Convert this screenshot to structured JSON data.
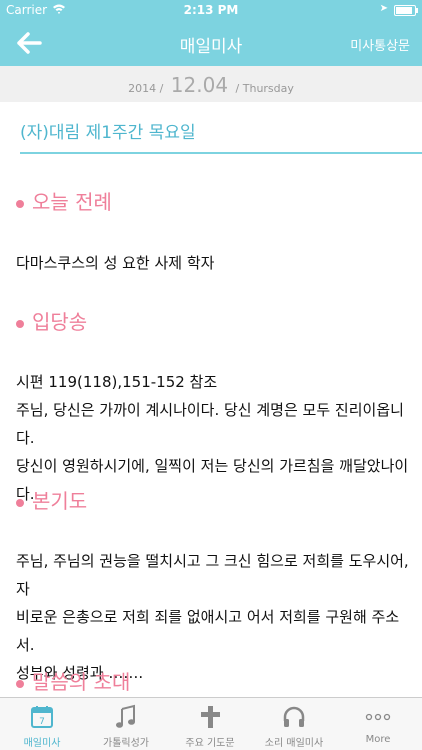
{
  "status": {
    "carrier": "Carrier",
    "time": "2:13 PM"
  },
  "nav": {
    "title": "매일미사",
    "right_label": "미사통상문"
  },
  "date": {
    "year": "2014 /",
    "day": "12.04",
    "weekday": "/ Thursday"
  },
  "header": "(자)대림 제1주간 목요일",
  "sections": [
    {
      "title": "오늘 전례",
      "body": [
        "다마스쿠스의 성 요한 사제 학자"
      ]
    },
    {
      "title": "입당송",
      "body": [
        "시편 119(118),151-152 참조",
        "주님, 당신은 가까이 계시나이다. 당신 계명은 모두 진리이옵니다.",
        "당신이 영원하시기에, 일찍이 저는 당신의 가르침을 깨달았나이다."
      ]
    },
    {
      "title": "본기도",
      "body": [
        "주님, 주님의 권능을 떨치시고 그 크신 힘으로 저희를 도우시어, 자",
        "비로운 은총으로 저희 죄를 없애시고 어서 저희를 구원해 주소서.",
        "성부와 성령과 ……."
      ]
    },
    {
      "title": "말씀의 초대",
      "body": []
    }
  ],
  "tabs": [
    {
      "label": "매일미사",
      "icon": "calendar-icon"
    },
    {
      "label": "가톨릭성가",
      "icon": "music-note-icon"
    },
    {
      "label": "주요 기도문",
      "icon": "cross-icon"
    },
    {
      "label": "소리 매일미사",
      "icon": "headphones-icon"
    },
    {
      "label": "More",
      "icon": "more-icon"
    }
  ],
  "calendar_day": "7",
  "colors": {
    "accent": "#7dd3e0",
    "section": "#ef7f9a",
    "header": "#4fb6ce"
  }
}
